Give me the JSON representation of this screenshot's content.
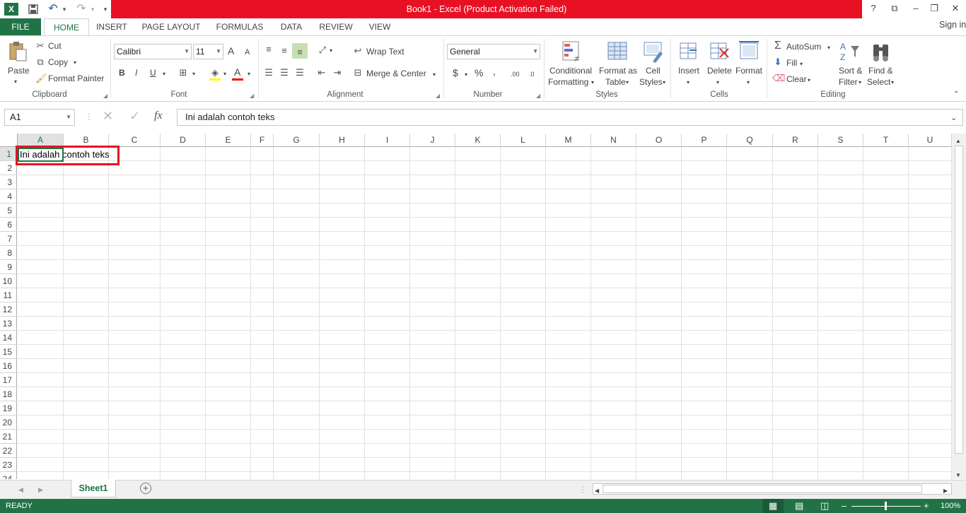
{
  "window": {
    "title": "Book1 -  Excel (Product Activation Failed)",
    "help": "?",
    "restore_ribbon": "⧉",
    "minimize": "–",
    "maximize": "❐",
    "close": "✕",
    "title_color": "#e81123"
  },
  "qat": {
    "excel_logo": "X",
    "save": "💾",
    "undo": "↶",
    "undo_dd": "▾",
    "redo": "↷",
    "redo_dd": "▾",
    "customize": "▾"
  },
  "tabs": [
    "FILE",
    "HOME",
    "INSERT",
    "PAGE LAYOUT",
    "FORMULAS",
    "DATA",
    "REVIEW",
    "VIEW"
  ],
  "signin": "Sign in",
  "ribbon": {
    "clipboard": {
      "paste": "Paste",
      "cut": "Cut",
      "copy": "Copy",
      "format_painter": "Format Painter",
      "label": "Clipboard"
    },
    "font": {
      "name": "Calibri",
      "size": "11",
      "bold": "B",
      "italic": "I",
      "underline": "U",
      "grow": "A",
      "shrink": "A",
      "font_color": "A",
      "label": "Font"
    },
    "alignment": {
      "wrap_text": "Wrap Text",
      "merge_center": "Merge & Center",
      "label": "Alignment"
    },
    "number": {
      "format": "General",
      "currency": "$",
      "percent": "%",
      "comma": ",",
      "inc_dec": ".00",
      "dec_dec": ".0",
      "label": "Number"
    },
    "styles": {
      "conditional": "Conditional",
      "conditional2": "Formatting",
      "format_as": "Format as",
      "format_as2": "Table",
      "cell": "Cell",
      "cell2": "Styles",
      "label": "Styles"
    },
    "cells": {
      "insert": "Insert",
      "delete": "Delete",
      "format": "Format",
      "label": "Cells"
    },
    "editing": {
      "autosum": "AutoSum",
      "fill": "Fill",
      "clear": "Clear",
      "sort": "Sort &",
      "sort2": "Filter",
      "find": "Find &",
      "find2": "Select",
      "label": "Editing"
    }
  },
  "formula_bar": {
    "name_box": "A1",
    "fx": "fx",
    "content": "Ini adalah contoh teks"
  },
  "grid": {
    "columns": [
      "A",
      "B",
      "C",
      "D",
      "E",
      "F",
      "G",
      "H",
      "I",
      "J",
      "K",
      "L",
      "M",
      "N",
      "O",
      "P",
      "Q",
      "R",
      "S",
      "T",
      "U"
    ],
    "rows": [
      "1",
      "2",
      "3",
      "4",
      "5",
      "6",
      "7",
      "8",
      "9",
      "10",
      "11",
      "12",
      "13",
      "14",
      "15",
      "16",
      "17",
      "18",
      "19",
      "20",
      "21",
      "22",
      "23",
      "24"
    ],
    "a1_value": "Ini adalah contoh teks",
    "selection_color": "#217346",
    "highlight_color": "#e81123"
  },
  "sheets": {
    "active": "Sheet1",
    "add": "+"
  },
  "status": {
    "ready": "READY",
    "zoom": "100%",
    "zoom_minus": "–",
    "zoom_plus": "+",
    "accent": "#217346"
  }
}
